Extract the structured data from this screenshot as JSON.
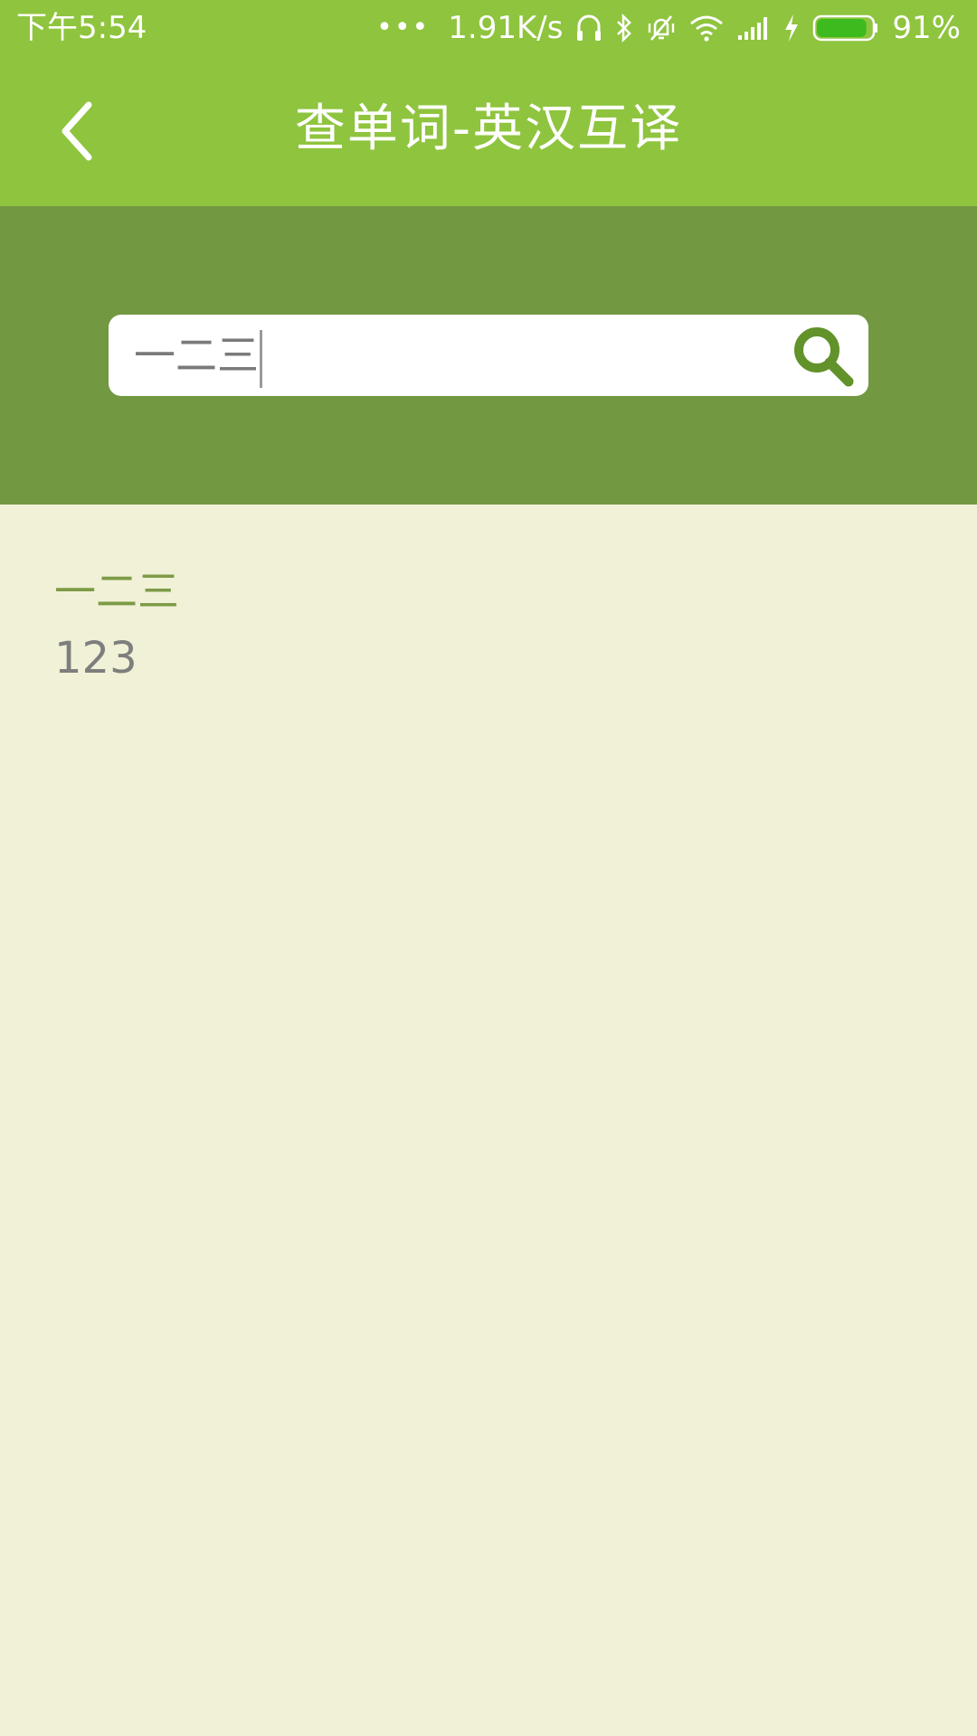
{
  "status_bar": {
    "time": "下午5:54",
    "more_dots": "•••",
    "network_speed": "1.91K/s",
    "battery_percent": "91%",
    "battery_level": 0.91,
    "battery_color": "#3DBB1E",
    "icons": [
      "headset-icon",
      "bluetooth-icon",
      "vibrate-mute-icon",
      "wifi-icon",
      "signal-icon",
      "charging-icon",
      "battery-icon"
    ]
  },
  "app_bar": {
    "title": "查单词-英汉互译",
    "back_icon": "chevron-left-icon",
    "background": "#8FC43E"
  },
  "search": {
    "value": "一二三",
    "button_icon": "search-icon",
    "panel_background": "#729841",
    "icon_color": "#62922A"
  },
  "result": {
    "word": "一二三",
    "translation": "123",
    "word_color": "#7D9B46",
    "background": "#F0F1D6"
  }
}
